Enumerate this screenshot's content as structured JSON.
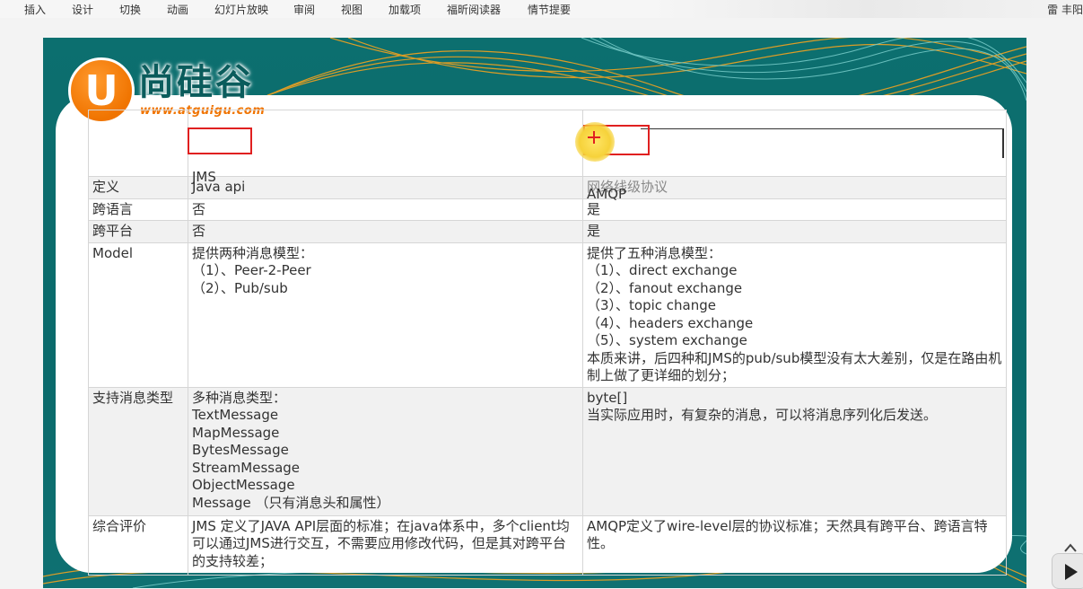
{
  "ribbon": {
    "tabs": [
      "插入",
      "设计",
      "切换",
      "动画",
      "幻灯片放映",
      "审阅",
      "视图",
      "加载项",
      "福昕阅读器",
      "情节提要"
    ],
    "user": "雷 丰阳"
  },
  "logo": {
    "mark": "U",
    "brand": "尚硅谷",
    "url": "www.atguigu.com"
  },
  "table": {
    "header": {
      "empty": "",
      "jms": "JMS",
      "amqp": "AMQP"
    },
    "rows": [
      {
        "label": "定义",
        "jms": "Java api",
        "amqp": "网络线级协议"
      },
      {
        "label": "跨语言",
        "jms": "否",
        "amqp": "是"
      },
      {
        "label": "跨平台",
        "jms": "否",
        "amqp": "是"
      },
      {
        "label": "Model",
        "jms": "提供两种消息模型：\n （1）、Peer-2-Peer\n （2）、Pub/sub",
        "amqp": "提供了五种消息模型：\n （1）、direct exchange\n （2）、fanout exchange\n （3）、topic change\n （4）、headers exchange\n （5）、system exchange\n本质来讲，后四种和JMS的pub/sub模型没有太大差别，仅是在路由机制上做了更详细的划分；"
      },
      {
        "label": "支持消息类型",
        "jms": "多种消息类型：\nTextMessage\nMapMessage\nBytesMessage\nStreamMessage\nObjectMessage\nMessage （只有消息头和属性）",
        "amqp": "byte[]\n当实际应用时，有复杂的消息，可以将消息序列化后发送。"
      },
      {
        "label": "综合评价",
        "jms": "JMS 定义了JAVA API层面的标准；在java体系中，多个client均可以通过JMS进行交互，不需要应用修改代码，但是其对跨平台的支持较差；",
        "amqp": "AMQP定义了wire-level层的协议标准；天然具有跨平台、跨语言特性。"
      }
    ]
  },
  "colors": {
    "slide_teal": "#0c6f6f",
    "logo_orange": "#f07400",
    "highlight_red": "#e02020",
    "cursor_yellow": "#f6d23a"
  },
  "icons": [
    "cursor-highlight-icon",
    "scroll-up-icon",
    "play-icon"
  ]
}
